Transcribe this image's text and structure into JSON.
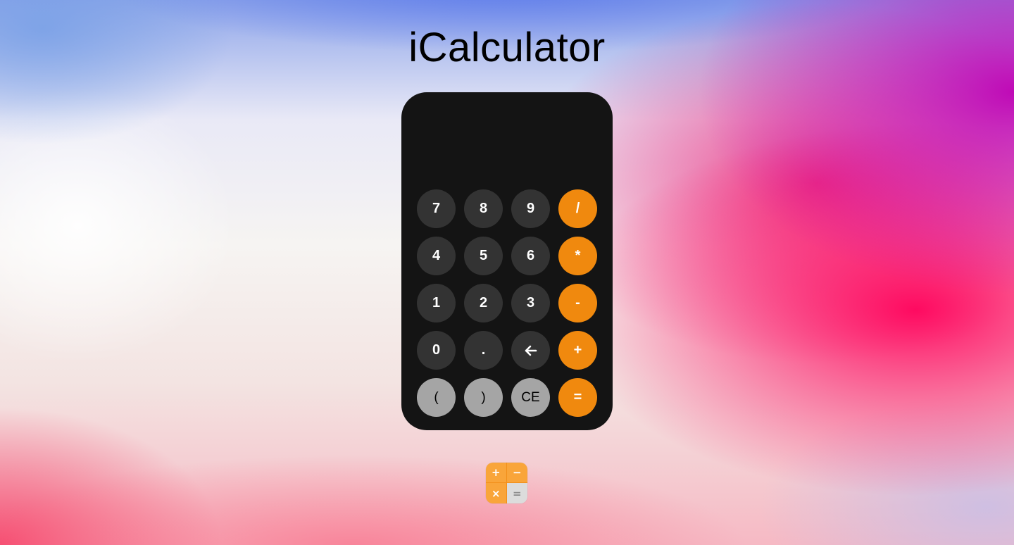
{
  "page": {
    "title": "iCalculator"
  },
  "display": {
    "value": ""
  },
  "keypad": {
    "rows": [
      [
        {
          "label": "7",
          "style": "dark",
          "name": "key-7"
        },
        {
          "label": "8",
          "style": "dark",
          "name": "key-8"
        },
        {
          "label": "9",
          "style": "dark",
          "name": "key-9"
        },
        {
          "label": "/",
          "style": "orange",
          "name": "key-divide"
        }
      ],
      [
        {
          "label": "4",
          "style": "dark",
          "name": "key-4"
        },
        {
          "label": "5",
          "style": "dark",
          "name": "key-5"
        },
        {
          "label": "6",
          "style": "dark",
          "name": "key-6"
        },
        {
          "label": "*",
          "style": "orange",
          "name": "key-multiply"
        }
      ],
      [
        {
          "label": "1",
          "style": "dark",
          "name": "key-1"
        },
        {
          "label": "2",
          "style": "dark",
          "name": "key-2"
        },
        {
          "label": "3",
          "style": "dark",
          "name": "key-3"
        },
        {
          "label": "-",
          "style": "orange",
          "name": "key-subtract"
        }
      ],
      [
        {
          "label": "0",
          "style": "dark",
          "name": "key-0"
        },
        {
          "label": ".",
          "style": "dark",
          "name": "key-decimal"
        },
        {
          "label": "🡐",
          "style": "dark",
          "name": "key-backspace",
          "icon": "backspace-arrow-icon"
        },
        {
          "label": "+",
          "style": "orange",
          "name": "key-add"
        }
      ],
      [
        {
          "label": "(",
          "style": "light",
          "name": "key-open-paren"
        },
        {
          "label": ")",
          "style": "light",
          "name": "key-close-paren"
        },
        {
          "label": "CE",
          "style": "light",
          "name": "key-clear-entry"
        },
        {
          "label": "=",
          "style": "orange",
          "name": "key-equals"
        }
      ]
    ]
  },
  "app_icon": {
    "icon": "calculator-app-icon",
    "plus": "+",
    "minus": "−",
    "times": "×",
    "equals": "="
  },
  "colors": {
    "calculator_body": "#141414",
    "key_dark": "#333333",
    "key_orange": "#f0890e",
    "key_light": "#a5a5a5",
    "icon_orange": "#f9a53a",
    "icon_grey": "#dcdcdc"
  }
}
